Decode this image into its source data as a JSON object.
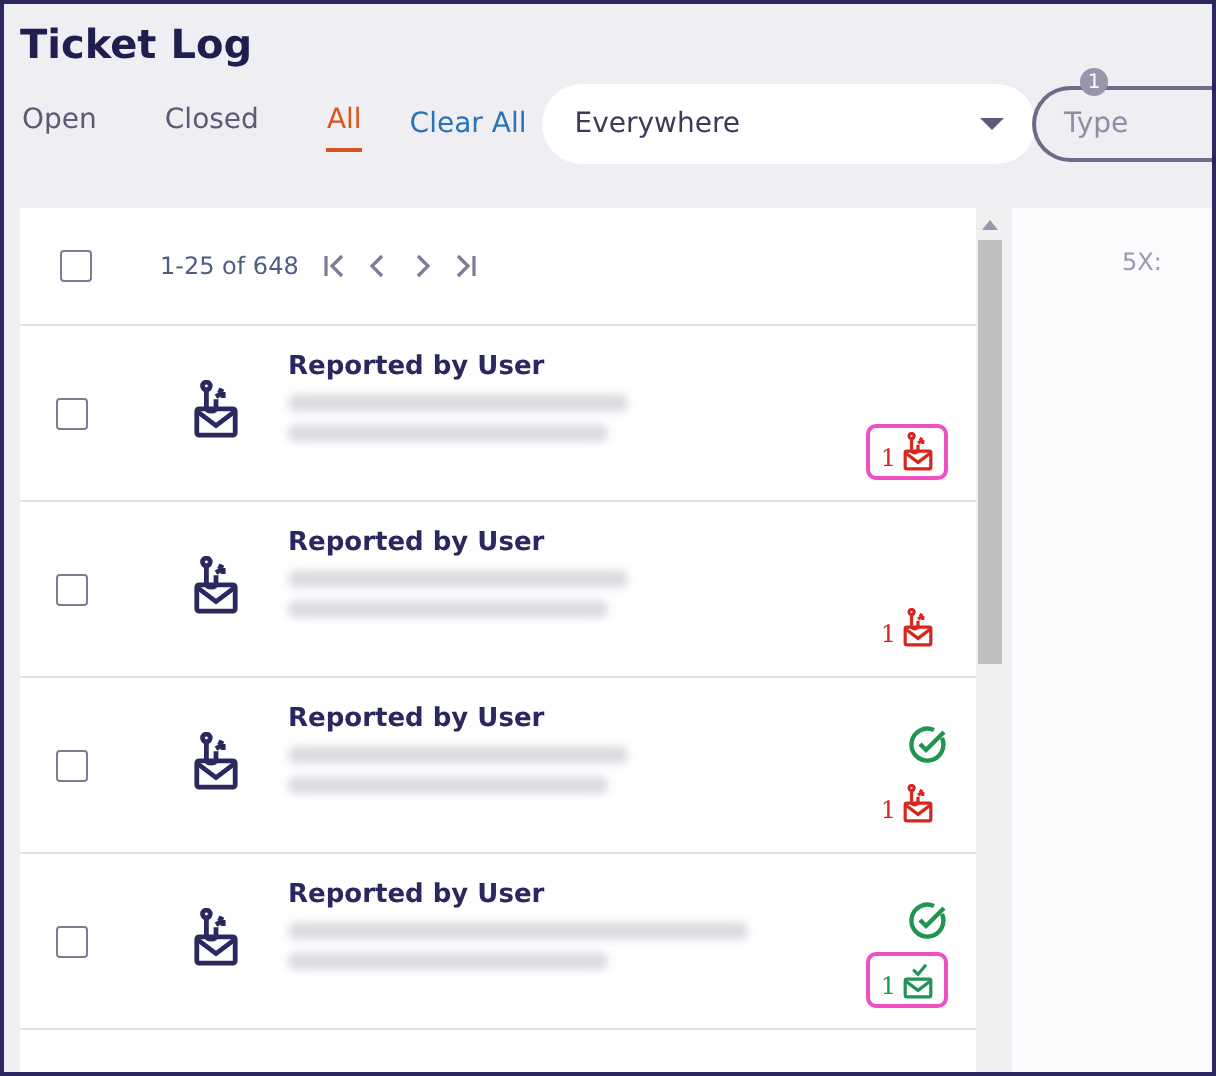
{
  "title": "Ticket Log",
  "tabs": [
    {
      "label": "Open",
      "selected": false
    },
    {
      "label": "Closed",
      "selected": false
    },
    {
      "label": "All",
      "selected": true
    }
  ],
  "clear_all": "Clear All",
  "location_select": {
    "value": "Everywhere"
  },
  "type_filter": {
    "placeholder": "Type",
    "badge": "1"
  },
  "pagination": {
    "range": "1-25 of 648",
    "all_checked": false
  },
  "side_panel": {
    "label": "5X:"
  },
  "tickets": [
    {
      "checked": false,
      "title": "Reported by User",
      "resolved": false,
      "kind": "reported",
      "count": "1",
      "highlighted": true
    },
    {
      "checked": false,
      "title": "Reported by User",
      "resolved": false,
      "kind": "reported",
      "count": "1",
      "highlighted": false
    },
    {
      "checked": false,
      "title": "Reported by User",
      "resolved": true,
      "kind": "reported",
      "count": "1",
      "highlighted": false
    },
    {
      "checked": false,
      "title": "Reported by User",
      "resolved": true,
      "kind": "safe",
      "count": "1",
      "highlighted": true
    }
  ]
}
